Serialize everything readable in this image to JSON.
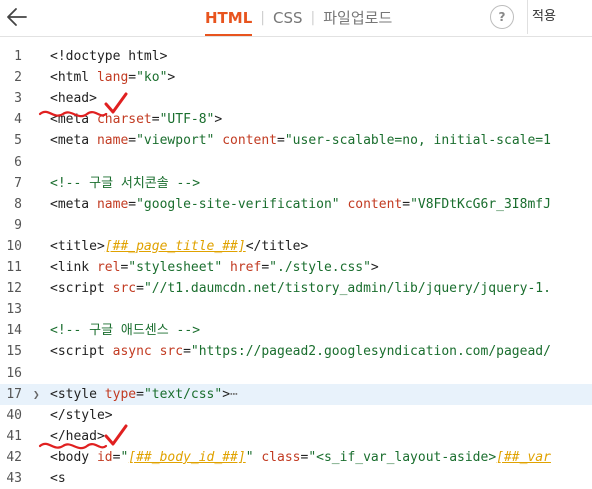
{
  "header": {
    "tabs": [
      {
        "label": "HTML",
        "active": true
      },
      {
        "label": "CSS",
        "active": false
      },
      {
        "label": "파일업로드",
        "active": false
      }
    ],
    "help_label": "?",
    "apply_label": "적용"
  },
  "colors": {
    "accent": "#e8541e",
    "attr": "#c23b22",
    "string": "#1a6e2e",
    "template": "#e0a200",
    "highlight": "#e8f2fb",
    "annotation": "#e02020"
  },
  "lines": [
    {
      "n": "1",
      "tokens": [
        {
          "t": "<!doctype html>",
          "c": "tag"
        }
      ]
    },
    {
      "n": "2",
      "tokens": [
        {
          "t": "<html ",
          "c": "tag"
        },
        {
          "t": "lang",
          "c": "attr"
        },
        {
          "t": "=",
          "c": "tag"
        },
        {
          "t": "\"ko\"",
          "c": "str"
        },
        {
          "t": ">",
          "c": "tag"
        }
      ]
    },
    {
      "n": "3",
      "tokens": [
        {
          "t": "<head>",
          "c": "tag"
        }
      ]
    },
    {
      "n": "4",
      "tokens": [
        {
          "t": "<meta ",
          "c": "tag"
        },
        {
          "t": "charset",
          "c": "attr"
        },
        {
          "t": "=",
          "c": "tag"
        },
        {
          "t": "\"UTF-8\"",
          "c": "str"
        },
        {
          "t": ">",
          "c": "tag"
        }
      ]
    },
    {
      "n": "5",
      "tokens": [
        {
          "t": "<meta ",
          "c": "tag"
        },
        {
          "t": "name",
          "c": "attr"
        },
        {
          "t": "=",
          "c": "tag"
        },
        {
          "t": "\"viewport\"",
          "c": "str"
        },
        {
          "t": " ",
          "c": "tag"
        },
        {
          "t": "content",
          "c": "attr"
        },
        {
          "t": "=",
          "c": "tag"
        },
        {
          "t": "\"user-scalable=no, initial-scale=1",
          "c": "str"
        }
      ]
    },
    {
      "n": "6",
      "tokens": []
    },
    {
      "n": "7",
      "tokens": [
        {
          "t": "<!-- 구글 서치콘솔 -->",
          "c": "com"
        }
      ]
    },
    {
      "n": "8",
      "tokens": [
        {
          "t": "<meta ",
          "c": "tag"
        },
        {
          "t": "name",
          "c": "attr"
        },
        {
          "t": "=",
          "c": "tag"
        },
        {
          "t": "\"google-site-verification\"",
          "c": "str"
        },
        {
          "t": " ",
          "c": "tag"
        },
        {
          "t": "content",
          "c": "attr"
        },
        {
          "t": "=",
          "c": "tag"
        },
        {
          "t": "\"V8FDtKcG6r_3I8mfJ",
          "c": "str"
        }
      ]
    },
    {
      "n": "9",
      "tokens": []
    },
    {
      "n": "10",
      "tokens": [
        {
          "t": "<title>",
          "c": "tag"
        },
        {
          "t": "[##_page_title_##]",
          "c": "tpl"
        },
        {
          "t": "</title>",
          "c": "tag"
        }
      ]
    },
    {
      "n": "11",
      "tokens": [
        {
          "t": "<link ",
          "c": "tag"
        },
        {
          "t": "rel",
          "c": "attr"
        },
        {
          "t": "=",
          "c": "tag"
        },
        {
          "t": "\"stylesheet\"",
          "c": "str"
        },
        {
          "t": " ",
          "c": "tag"
        },
        {
          "t": "href",
          "c": "attr"
        },
        {
          "t": "=",
          "c": "tag"
        },
        {
          "t": "\"./style.css\"",
          "c": "str"
        },
        {
          "t": ">",
          "c": "tag"
        }
      ]
    },
    {
      "n": "12",
      "tokens": [
        {
          "t": "<script ",
          "c": "tag"
        },
        {
          "t": "src",
          "c": "attr"
        },
        {
          "t": "=",
          "c": "tag"
        },
        {
          "t": "\"//t1.daumcdn.net/tistory_admin/lib/jquery/jquery-1.",
          "c": "str"
        }
      ]
    },
    {
      "n": "13",
      "tokens": []
    },
    {
      "n": "14",
      "tokens": [
        {
          "t": "<!-- 구글 애드센스 -->",
          "c": "com"
        }
      ]
    },
    {
      "n": "15",
      "tokens": [
        {
          "t": "<script ",
          "c": "tag"
        },
        {
          "t": "async ",
          "c": "attr"
        },
        {
          "t": "src",
          "c": "attr"
        },
        {
          "t": "=",
          "c": "tag"
        },
        {
          "t": "\"https://pagead2.googlesyndication.com/pagead/",
          "c": "str"
        }
      ]
    },
    {
      "n": "16",
      "tokens": []
    },
    {
      "n": "17",
      "tokens": [
        {
          "t": "<style ",
          "c": "tag"
        },
        {
          "t": "type",
          "c": "attr"
        },
        {
          "t": "=",
          "c": "tag"
        },
        {
          "t": "\"text/css\"",
          "c": "str"
        },
        {
          "t": ">",
          "c": "tag"
        },
        {
          "t": "⋯",
          "c": "dots"
        }
      ],
      "folded": true,
      "highlight": true
    },
    {
      "n": "40",
      "tokens": [
        {
          "t": "</style>",
          "c": "tag"
        }
      ]
    },
    {
      "n": "41",
      "tokens": [
        {
          "t": "</head>",
          "c": "tag"
        }
      ]
    },
    {
      "n": "42",
      "tokens": [
        {
          "t": "<body ",
          "c": "tag"
        },
        {
          "t": "id",
          "c": "attr"
        },
        {
          "t": "=",
          "c": "tag"
        },
        {
          "t": "\"",
          "c": "str"
        },
        {
          "t": "[##_body_id_##]",
          "c": "tpl"
        },
        {
          "t": "\"",
          "c": "str"
        },
        {
          "t": " ",
          "c": "tag"
        },
        {
          "t": "class",
          "c": "attr"
        },
        {
          "t": "=",
          "c": "tag"
        },
        {
          "t": "\"<s_if_var_layout-aside>",
          "c": "str"
        },
        {
          "t": "[##_var",
          "c": "tpl"
        }
      ]
    },
    {
      "n": "43",
      "tokens": [
        {
          "t": "<s",
          "c": "tag"
        }
      ]
    }
  ]
}
